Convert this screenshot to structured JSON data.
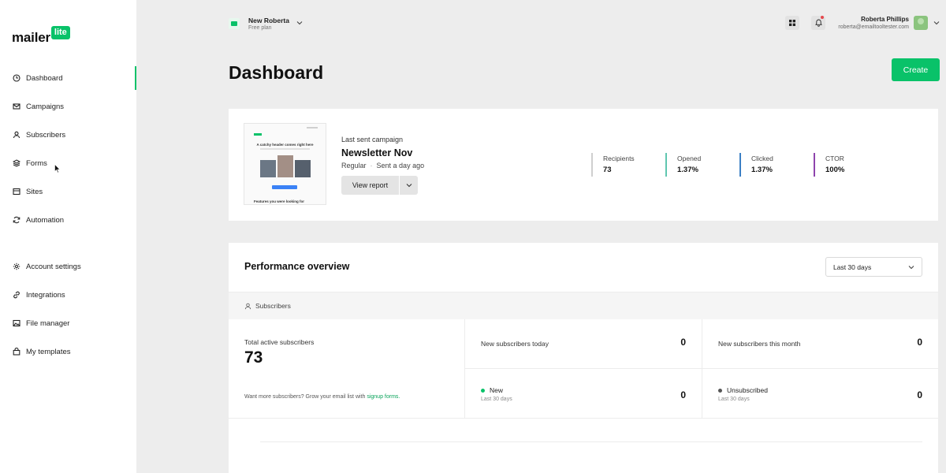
{
  "logo": {
    "text": "mailer",
    "badge": "lite"
  },
  "sidebar": {
    "items": [
      {
        "label": "Dashboard",
        "icon": "dashboard-icon"
      },
      {
        "label": "Campaigns",
        "icon": "mail-icon"
      },
      {
        "label": "Subscribers",
        "icon": "user-icon"
      },
      {
        "label": "Forms",
        "icon": "layers-icon"
      },
      {
        "label": "Sites",
        "icon": "browser-icon"
      },
      {
        "label": "Automation",
        "icon": "refresh-icon"
      }
    ],
    "secondary": [
      {
        "label": "Account settings",
        "icon": "gear-icon"
      },
      {
        "label": "Integrations",
        "icon": "link-icon"
      },
      {
        "label": "File manager",
        "icon": "image-icon"
      },
      {
        "label": "My templates",
        "icon": "bag-icon"
      }
    ],
    "active_index": 0
  },
  "workspace": {
    "name": "New Roberta",
    "plan": "Free plan"
  },
  "user": {
    "name": "Roberta Phillips",
    "email": "roberta@emailtooltester.com"
  },
  "page": {
    "title": "Dashboard",
    "create_label": "Create"
  },
  "campaign": {
    "label": "Last sent campaign",
    "name": "Newsletter Nov",
    "type": "Regular",
    "sent": "Sent a day ago",
    "report_label": "View report",
    "thumb_header": "A catchy header comes right here",
    "thumb_footer": "Features you were looking for",
    "stats": [
      {
        "label": "Recipients",
        "value": "73",
        "color": "#cfcfcf"
      },
      {
        "label": "Opened",
        "value": "1.37%",
        "color": "#5fc6b0"
      },
      {
        "label": "Clicked",
        "value": "1.37%",
        "color": "#3b7fc4"
      },
      {
        "label": "CTOR",
        "value": "100%",
        "color": "#8e44ad"
      }
    ]
  },
  "performance": {
    "title": "Performance overview",
    "range": "Last 30 days",
    "section": "Subscribers",
    "total_label": "Total active subscribers",
    "total_value": "73",
    "promo_text": "Want more subscribers? Grow your email list with ",
    "promo_link": "signup forms.",
    "today_label": "New subscribers today",
    "today_value": "0",
    "month_label": "New subscribers this month",
    "month_value": "0",
    "new_label": "New",
    "new_sub": "Last 30 days",
    "new_value": "0",
    "new_color": "#09c269",
    "unsub_label": "Unsubscribed",
    "unsub_sub": "Last 30 days",
    "unsub_value": "0",
    "unsub_color": "#555555"
  }
}
